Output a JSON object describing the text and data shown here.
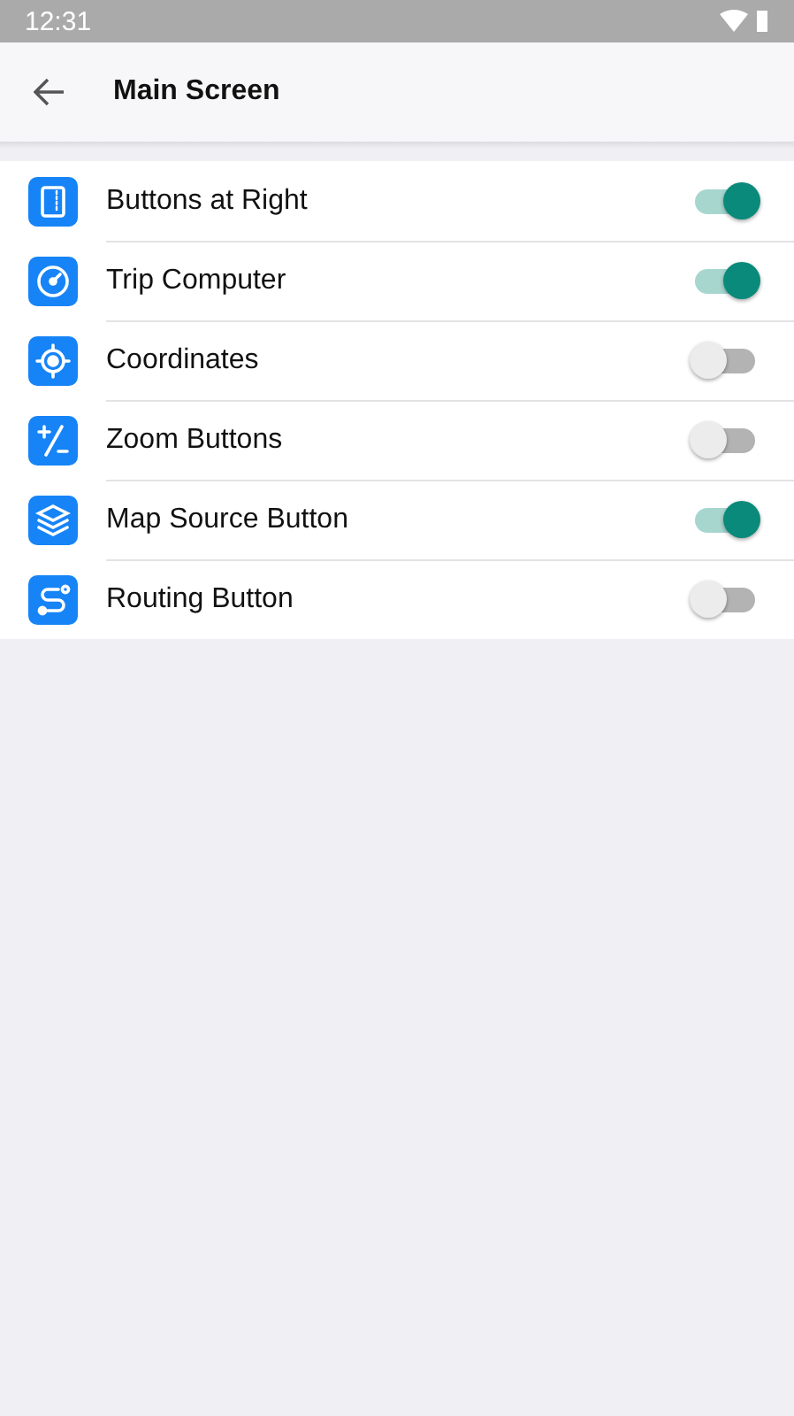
{
  "status_bar": {
    "time": "12:31"
  },
  "header": {
    "title": "Main Screen"
  },
  "settings": [
    {
      "label": "Buttons at Right",
      "on": true
    },
    {
      "label": "Trip Computer",
      "on": true
    },
    {
      "label": "Coordinates",
      "on": false
    },
    {
      "label": "Zoom Buttons",
      "on": false
    },
    {
      "label": "Map Source Button",
      "on": true
    },
    {
      "label": "Routing Button",
      "on": false
    }
  ]
}
